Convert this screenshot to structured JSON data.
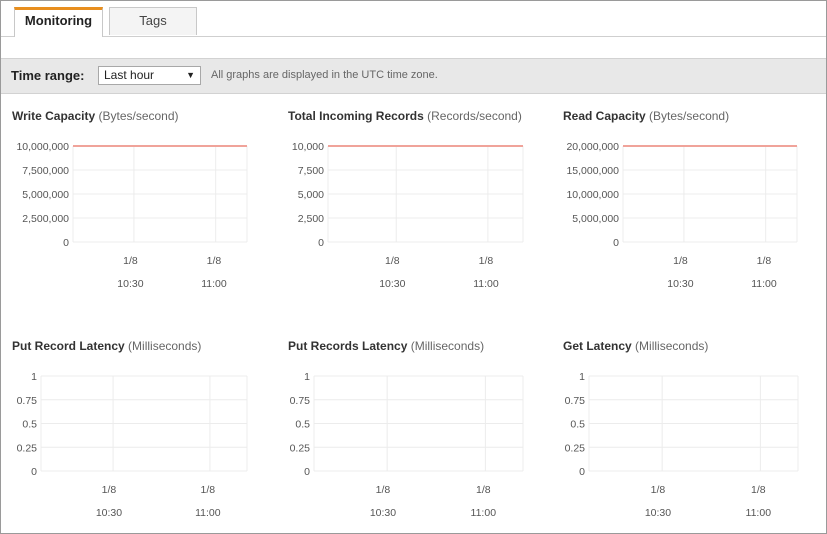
{
  "tabs": [
    {
      "label": "Monitoring",
      "active": true
    },
    {
      "label": "Tags",
      "active": false
    }
  ],
  "toolbar": {
    "time_range_label": "Time range:",
    "time_range_value": "Last hour",
    "note": "All graphs are displayed in the UTC time zone."
  },
  "colors": {
    "line": "#f0a39a",
    "grid": "#ececec"
  },
  "chart_data": [
    {
      "type": "line",
      "title": "Write Capacity",
      "unit": "(Bytes/second)",
      "yticks": [
        "0",
        "2,500,000",
        "5,000,000",
        "7,500,000",
        "10,000,000"
      ],
      "ylim": [
        0,
        10000000
      ],
      "xticks": [
        {
          "date": "1/8",
          "time": "10:30"
        },
        {
          "date": "1/8",
          "time": "11:00"
        }
      ],
      "series": [
        {
          "values": [
            10000000,
            10000000
          ]
        }
      ]
    },
    {
      "type": "line",
      "title": "Total Incoming Records",
      "unit": "(Records/second)",
      "yticks": [
        "0",
        "2,500",
        "5,000",
        "7,500",
        "10,000"
      ],
      "ylim": [
        0,
        10000
      ],
      "xticks": [
        {
          "date": "1/8",
          "time": "10:30"
        },
        {
          "date": "1/8",
          "time": "11:00"
        }
      ],
      "series": [
        {
          "values": [
            10000,
            10000
          ]
        }
      ]
    },
    {
      "type": "line",
      "title": "Read Capacity",
      "unit": "(Bytes/second)",
      "yticks": [
        "0",
        "5,000,000",
        "10,000,000",
        "15,000,000",
        "20,000,000"
      ],
      "ylim": [
        0,
        20000000
      ],
      "xticks": [
        {
          "date": "1/8",
          "time": "10:30"
        },
        {
          "date": "1/8",
          "time": "11:00"
        }
      ],
      "series": [
        {
          "values": [
            20000000,
            20000000
          ]
        }
      ]
    },
    {
      "type": "line",
      "title": "Put Record Latency",
      "unit": "(Milliseconds)",
      "yticks": [
        "0",
        "0.25",
        "0.5",
        "0.75",
        "1"
      ],
      "ylim": [
        0,
        1
      ],
      "xticks": [
        {
          "date": "1/8",
          "time": "10:30"
        },
        {
          "date": "1/8",
          "time": "11:00"
        }
      ],
      "series": []
    },
    {
      "type": "line",
      "title": "Put Records Latency",
      "unit": "(Milliseconds)",
      "yticks": [
        "0",
        "0.25",
        "0.5",
        "0.75",
        "1"
      ],
      "ylim": [
        0,
        1
      ],
      "xticks": [
        {
          "date": "1/8",
          "time": "10:30"
        },
        {
          "date": "1/8",
          "time": "11:00"
        }
      ],
      "series": []
    },
    {
      "type": "line",
      "title": "Get Latency",
      "unit": "(Milliseconds)",
      "yticks": [
        "0",
        "0.25",
        "0.5",
        "0.75",
        "1"
      ],
      "ylim": [
        0,
        1
      ],
      "xticks": [
        {
          "date": "1/8",
          "time": "10:30"
        },
        {
          "date": "1/8",
          "time": "11:00"
        }
      ],
      "series": []
    }
  ]
}
